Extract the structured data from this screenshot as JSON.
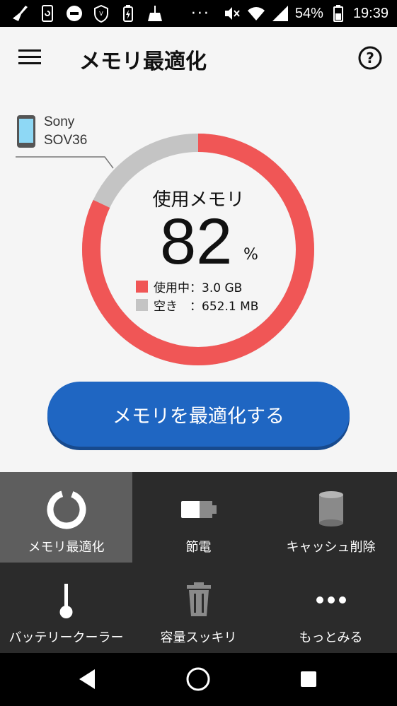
{
  "status_bar": {
    "battery_percent": "54%",
    "time": "19:39",
    "dots": "···"
  },
  "app_bar": {
    "title": "メモリ最適化"
  },
  "device": {
    "name": "Sony",
    "model": "SOV36"
  },
  "memory": {
    "label": "使用メモリ",
    "percent": "82",
    "unit": "%",
    "usage_fraction": 0.82,
    "used_label": "使用中：3.0 GB",
    "free_label": "空き　：652.1 MB"
  },
  "colors": {
    "used": "#f05656",
    "free": "#c4c4c4",
    "button": "#1f66c2",
    "grid_bg": "#2b2b2b",
    "tile_active": "#5e5e5e",
    "badge": "#e33b3b"
  },
  "optimize_button": {
    "label": "メモリを最適化する"
  },
  "tiles": [
    {
      "label": "メモリ最適化",
      "icon": "ring-icon",
      "active": true
    },
    {
      "label": "節電",
      "icon": "battery-icon"
    },
    {
      "label": "キャッシュ削除",
      "icon": "cylinder-icon"
    },
    {
      "label": "バッテリークーラー",
      "icon": "thermometer-icon",
      "badge": true
    },
    {
      "label": "容量スッキリ",
      "icon": "trash-icon"
    },
    {
      "label": "もっとみる",
      "icon": "more-icon"
    }
  ]
}
